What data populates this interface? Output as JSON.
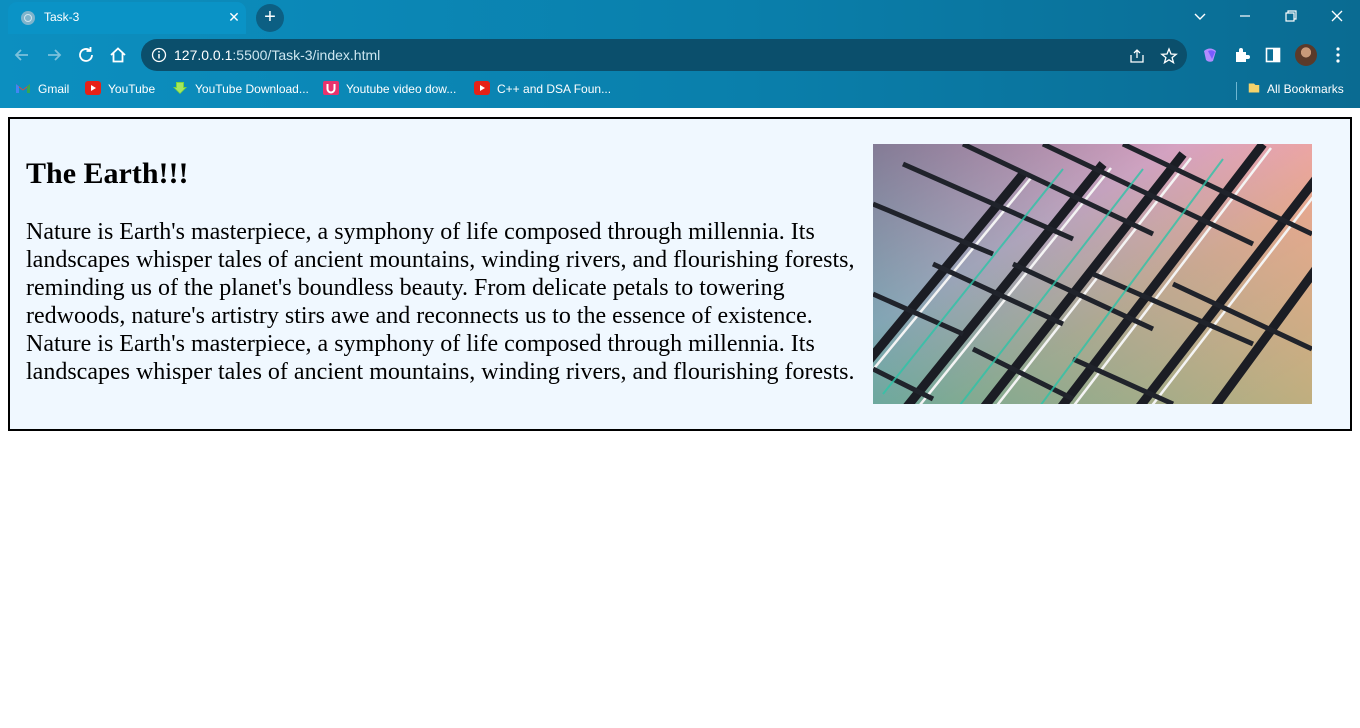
{
  "browser": {
    "tab": {
      "title": "Task-3"
    },
    "address": {
      "host": "127.0.0.1",
      "rest": ":5500/Task-3/index.html"
    },
    "bookmarks": [
      {
        "label": "Gmail",
        "icon": "gmail-icon"
      },
      {
        "label": "YouTube",
        "icon": "youtube-icon"
      },
      {
        "label": "YouTube Download...",
        "icon": "download-icon"
      },
      {
        "label": "Youtube video dow...",
        "icon": "u-logo-icon"
      },
      {
        "label": "C++ and DSA Foun...",
        "icon": "youtube-icon"
      }
    ],
    "all_bookmarks": "All Bookmarks",
    "colors": {
      "accent": "#0a93c6",
      "omnibox": "#0b4f6c"
    }
  },
  "page": {
    "heading": "The Earth!!!",
    "paragraph": "Nature is Earth's masterpiece, a symphony of life composed through millennia. Its landscapes whisper tales of ancient mountains, winding rivers, and flourishing forests, reminding us of the planet's boundless beauty. From delicate petals to towering redwoods, nature's artistry stirs awe and reconnects us to the essence of existence. Nature is Earth's masterpiece, a symphony of life composed through millennia. Its landscapes whisper tales of ancient mountains, winding rivers, and flourishing forests.",
    "colors": {
      "card_background": "#f0f8ff",
      "border": "#000000"
    }
  }
}
